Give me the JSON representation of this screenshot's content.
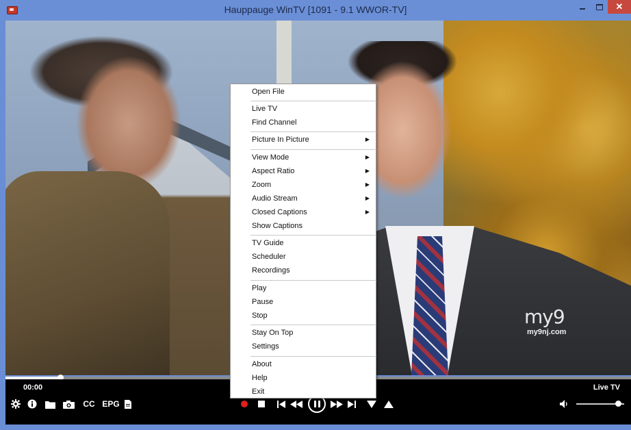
{
  "window": {
    "title": "Hauppauge WinTV [1091 - 9.1  WWOR-TV]",
    "close_label": "✕"
  },
  "video": {
    "logo_text": "my9",
    "logo_url": "my9nj.com"
  },
  "playback": {
    "time": "00:00",
    "mode_label": "Live TV",
    "progress_fraction": 0.088,
    "volume_fraction": 0.87
  },
  "toolbar": {
    "cc_label": "CC",
    "epg_label": "EPG"
  },
  "menu": {
    "items": [
      {
        "label": "Open File",
        "submenu": false
      },
      {
        "label": "Live TV",
        "submenu": false
      },
      {
        "label": "Find Channel",
        "submenu": false
      },
      {
        "label": "Picture In Picture",
        "submenu": true
      },
      {
        "label": "View Mode",
        "submenu": true
      },
      {
        "label": "Aspect Ratio",
        "submenu": true
      },
      {
        "label": "Zoom",
        "submenu": true
      },
      {
        "label": "Audio Stream",
        "submenu": true
      },
      {
        "label": "Closed Captions",
        "submenu": true
      },
      {
        "label": "Show Captions",
        "submenu": false
      },
      {
        "label": "TV Guide",
        "submenu": false
      },
      {
        "label": "Scheduler",
        "submenu": false
      },
      {
        "label": "Recordings",
        "submenu": false
      },
      {
        "label": "Play",
        "submenu": false
      },
      {
        "label": "Pause",
        "submenu": false
      },
      {
        "label": "Stop",
        "submenu": false
      },
      {
        "label": "Stay On Top",
        "submenu": false
      },
      {
        "label": "Settings",
        "submenu": false
      },
      {
        "label": "About",
        "submenu": false
      },
      {
        "label": "Help",
        "submenu": false
      },
      {
        "label": "Exit",
        "submenu": false
      }
    ],
    "submenu_arrow": "▶"
  },
  "colors": {
    "titlebar": "#6b8fd6",
    "close_button": "#c7483e",
    "record": "#e0201d"
  }
}
